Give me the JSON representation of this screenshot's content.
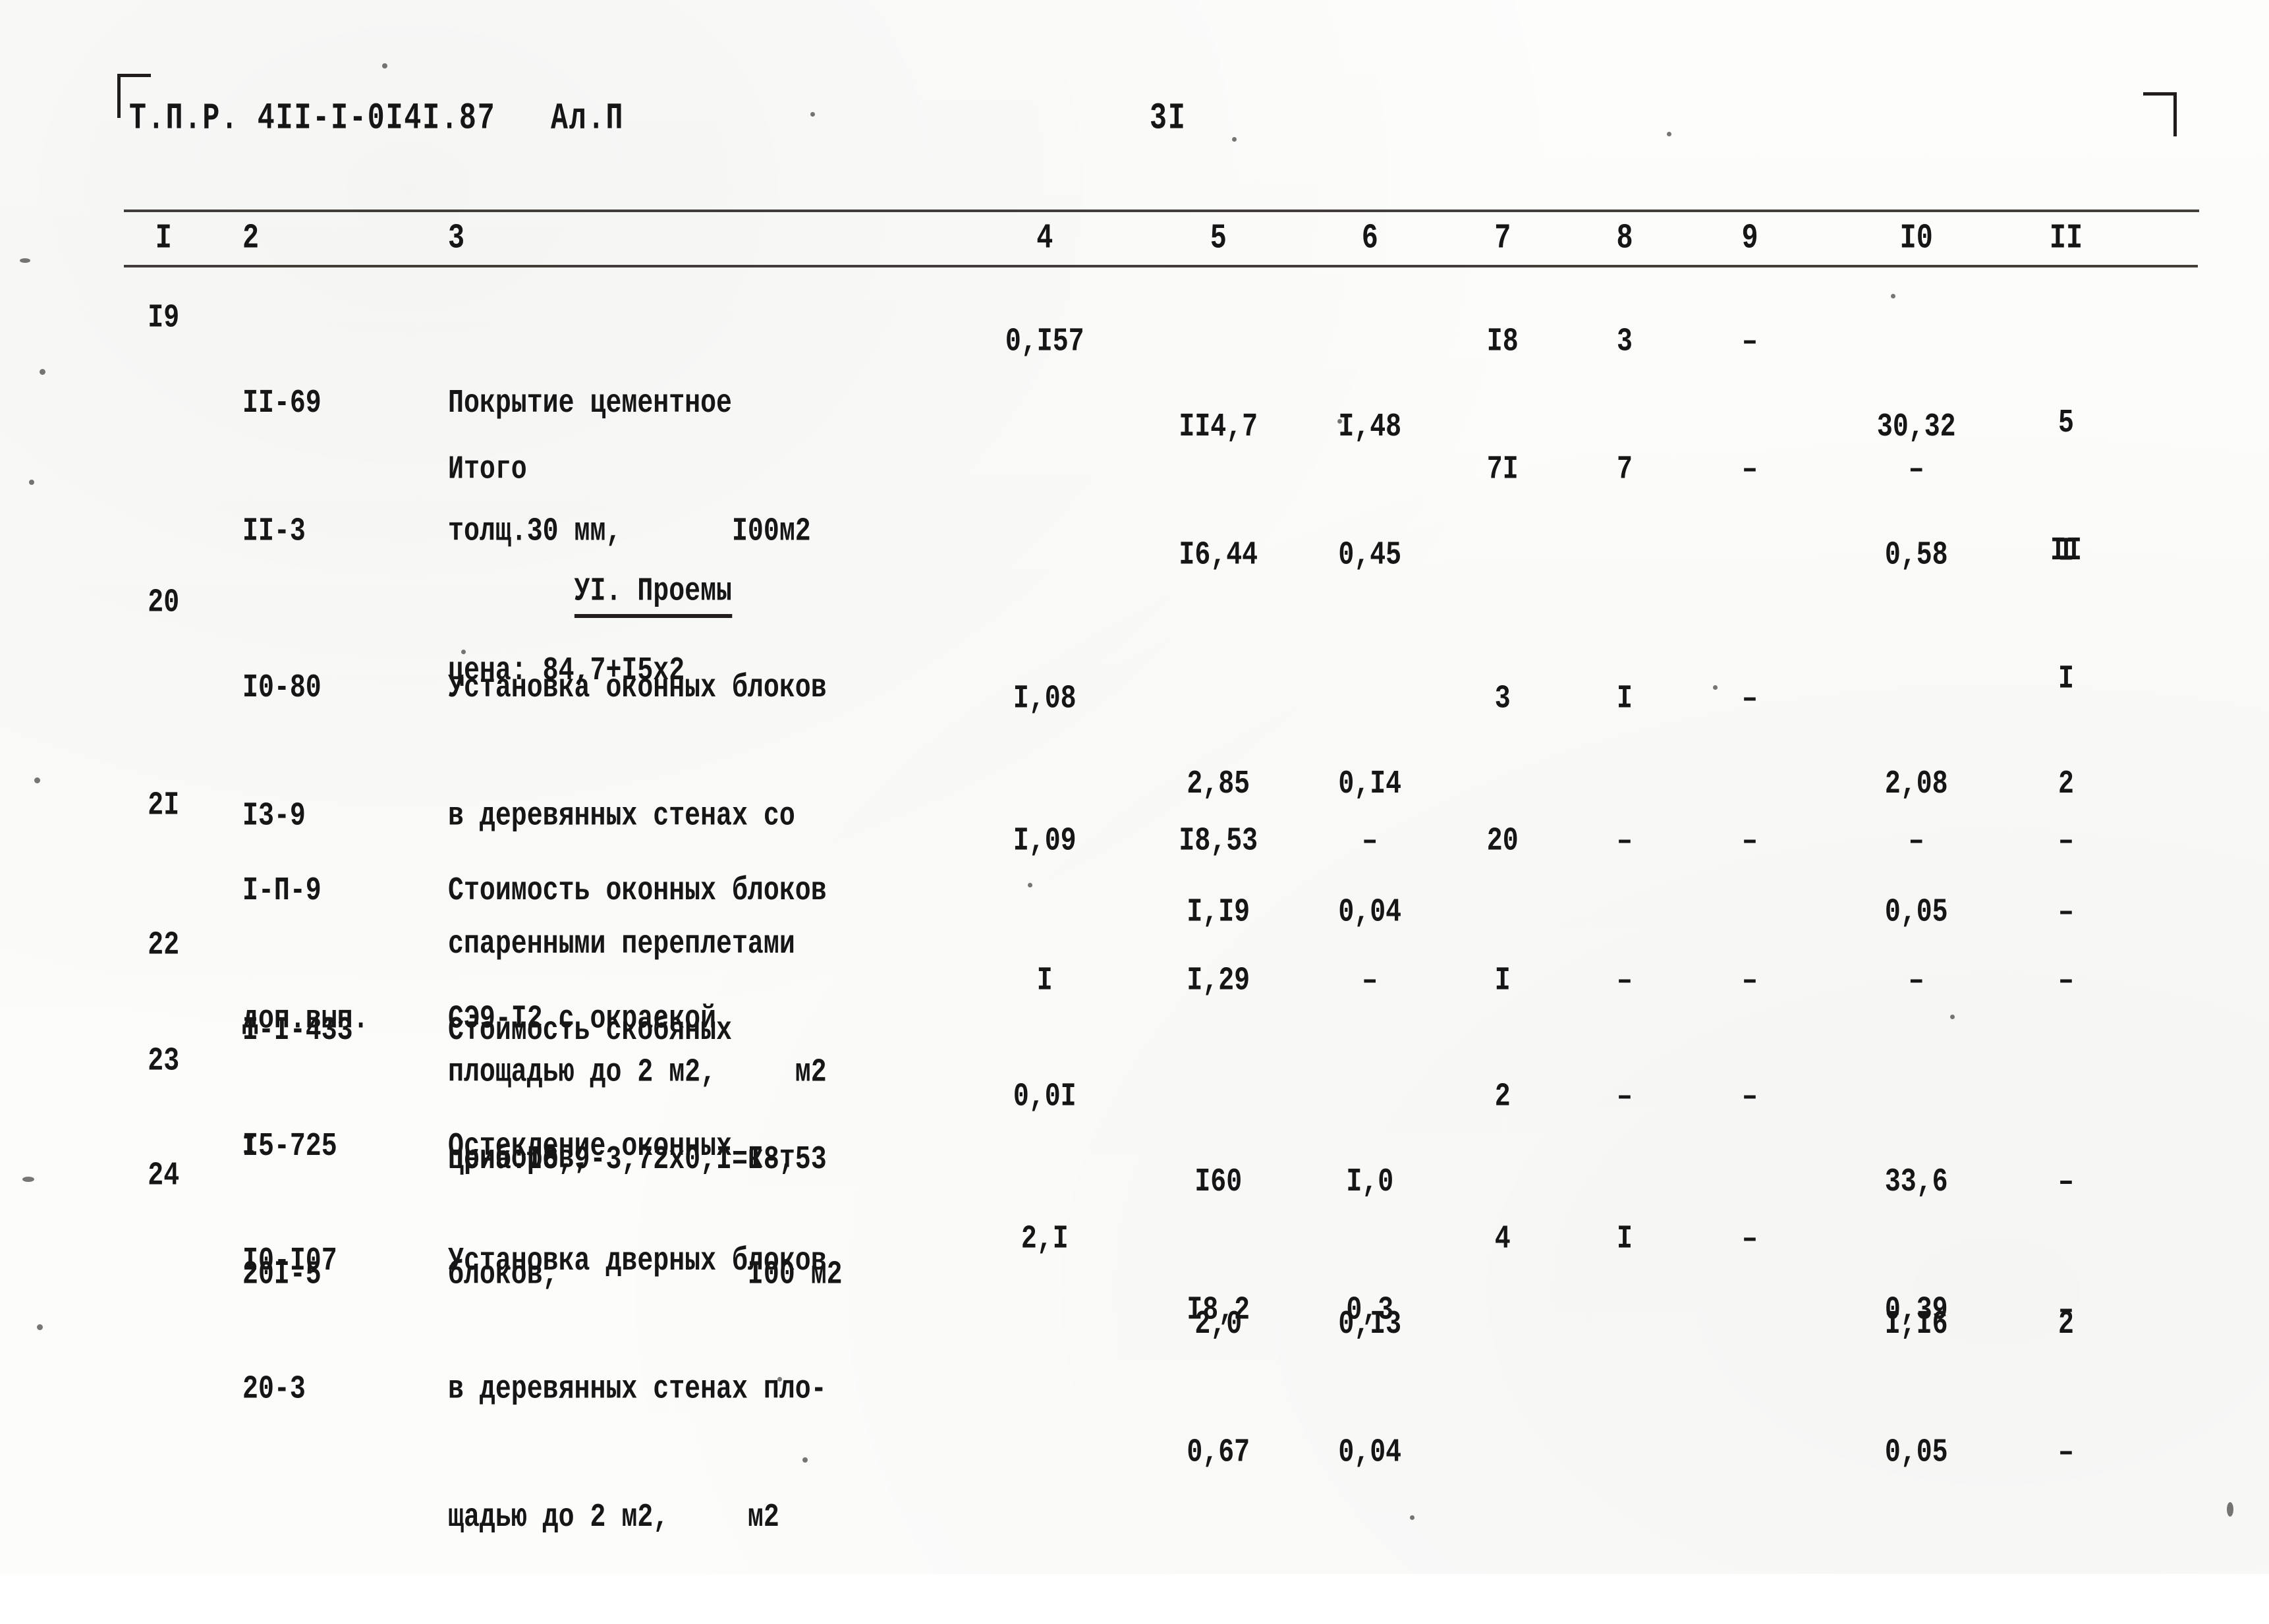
{
  "document": {
    "header_code": "Т.П.Р. 4II-I-0I4I.87   Ал.П",
    "page_number": "3I"
  },
  "table": {
    "column_headers": [
      "I",
      "2",
      "3",
      "4",
      "5",
      "6",
      "7",
      "8",
      "9",
      "I0",
      "II"
    ],
    "rows": [
      {
        "id": "row-19",
        "col1": "I9",
        "col2_line1": "II-69",
        "col2_line2": "II-3",
        "col3_line1": "Покрытие цементное",
        "col3_line2": "толщ.30 мм,       I00м2",
        "col3_line3": "цена: 84,7+I5x2",
        "col4": "0,I57",
        "col5_top": "II4,7",
        "col5_bot": "I6,44",
        "col6_top": "I,48",
        "col6_bot": "0,45",
        "col7": "I8",
        "col8": "3",
        "col9": "–",
        "col10_top": "30,32",
        "col10_bot": "0,58",
        "col11_top": "5",
        "col11_bot": "I"
      },
      {
        "id": "row-itogo",
        "col1": "",
        "col2_line1": "",
        "col2_line2": "",
        "col3_line1": "Итого",
        "col3_line2": "",
        "col3_line3": "",
        "col4": "",
        "col5_top": "",
        "col5_bot": "",
        "col6_top": "",
        "col6_bot": "",
        "col7": "7I",
        "col8": "7",
        "col9": "–",
        "col10_top": "–",
        "col10_bot": "",
        "col11_top": "II",
        "col11_bot": "I"
      },
      {
        "id": "row-20",
        "col1": "20",
        "col2_line1": "I0-80",
        "col2_line2": "I3-9",
        "col3_line1": "Установка оконных блоков",
        "col3_line2": "в деревянных стенах со",
        "col3_line3": "спаренными переплетами",
        "col3_line4": "площадью до 2 м2,     м2",
        "col4": "I,08",
        "col5_top": "2,85",
        "col5_bot": "I,I9",
        "col6_top": "0,I4",
        "col6_bot": "0,04",
        "col7": "3",
        "col8": "I",
        "col9": "–",
        "col10_top": "2,08",
        "col10_bot": "0,05",
        "col11_top": "2",
        "col11_bot": "–"
      },
      {
        "id": "row-21",
        "col1": "2I",
        "col2_line1": "I-П-9",
        "col2_line2": "доп.вып.",
        "col2_line3": "I",
        "col3_line1": "Стоимость оконных блоков",
        "col3_line2": "СЭ9-I2 с окраской",
        "col3_line3": "цена:I8,9-3,72x0,I=I8,53",
        "col4": "I,09",
        "col5_top": "I8,53",
        "col5_bot": "",
        "col6_top": "–",
        "col6_bot": "",
        "col7": "20",
        "col8": "–",
        "col9": "–",
        "col10_top": "–",
        "col10_bot": "",
        "col11_top": "–",
        "col11_bot": ""
      },
      {
        "id": "row-22",
        "col1": "22",
        "col2_line1": "I-I-433",
        "col2_line2": "",
        "col3_line1": "Стоимость скобяных",
        "col3_line2": "приборов,          к-т",
        "col3_line3": "",
        "col4": "I",
        "col5_top": "I,29",
        "col5_bot": "",
        "col6_top": "–",
        "col6_bot": "",
        "col7": "I",
        "col8": "–",
        "col9": "–",
        "col10_top": "–",
        "col10_bot": "",
        "col11_top": "–",
        "col11_bot": ""
      },
      {
        "id": "row-23",
        "col1": "23",
        "col2_line1": "I5-725",
        "col2_line2": "20I-5",
        "col3_line1": "Остекление оконных",
        "col3_line2": "блоков,            I00 м2",
        "col3_line3": "",
        "col4": "0,0I",
        "col5_top": "I60",
        "col5_bot": "I8,2",
        "col6_top": "I,0",
        "col6_bot": "0,3",
        "col7": "2",
        "col8": "–",
        "col9": "–",
        "col10_top": "33,6",
        "col10_bot": "0,39",
        "col11_top": "–",
        "col11_bot": "–"
      },
      {
        "id": "row-24",
        "col1": "24",
        "col2_line1": "I0-I07",
        "col2_line2": "20-3",
        "col3_line1": "Установка дверных блоков",
        "col3_line2": "в деревянных стенах пло-",
        "col3_line3": "щадью до 2 м2,     м2",
        "col4": "2,I",
        "col5_top": "2,0",
        "col5_bot": "0,67",
        "col6_top": "0,I3",
        "col6_bot": "0,04",
        "col7": "4",
        "col8": "I",
        "col9": "–",
        "col10_top": "I,I6",
        "col10_bot": "0,05",
        "col11_top": "2",
        "col11_bot": "–"
      }
    ],
    "section_heading": "УI. Проемы"
  }
}
